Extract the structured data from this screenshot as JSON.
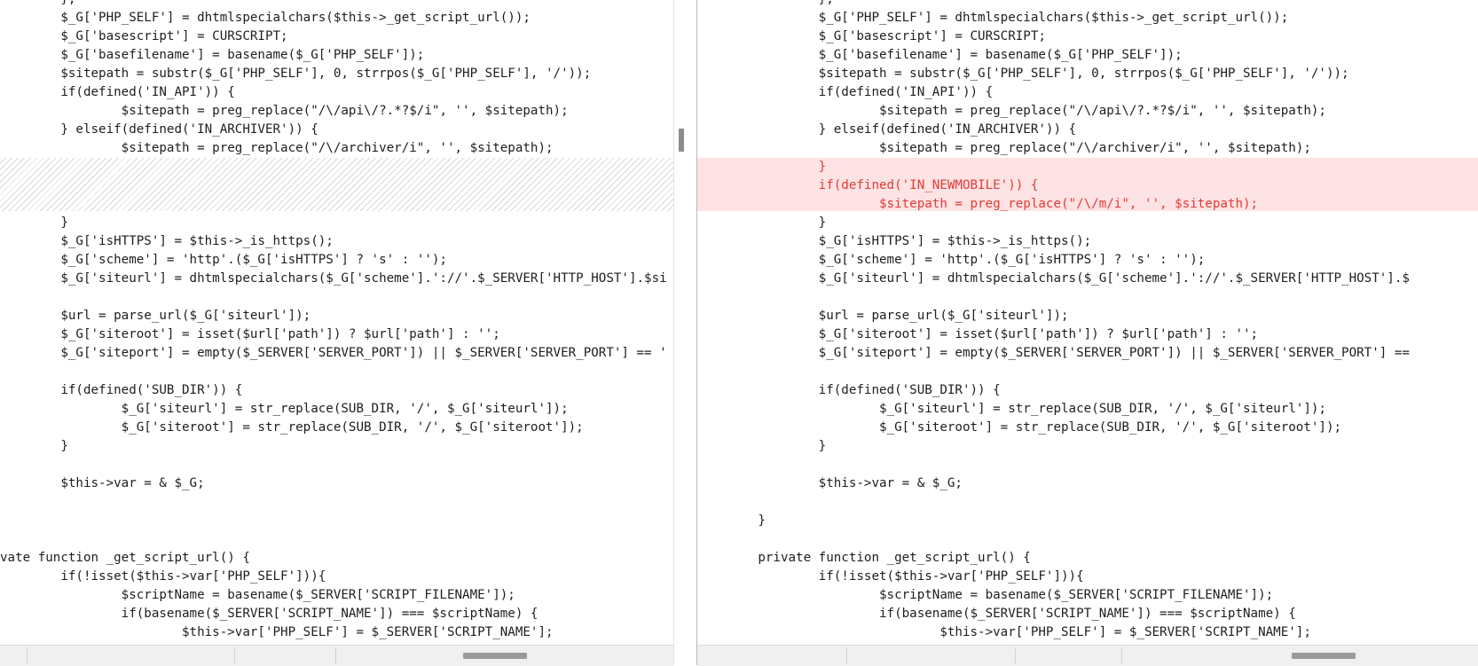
{
  "left_pane": {
    "lines": [
      "        },",
      "        $_G['PHP_SELF'] = dhtmlspecialchars($this->_get_script_url());",
      "        $_G['basescript'] = CURSCRIPT;",
      "        $_G['basefilename'] = basename($_G['PHP_SELF']);",
      "        $sitepath = substr($_G['PHP_SELF'], 0, strrpos($_G['PHP_SELF'], '/'));",
      "        if(defined('IN_API')) {",
      "                $sitepath = preg_replace(\"/\\/api\\/?.*?$/i\", '', $sitepath);",
      "        } elseif(defined('IN_ARCHIVER')) {",
      "                $sitepath = preg_replace(\"/\\/archiver/i\", '', $sitepath);",
      "",
      "",
      "",
      "        }",
      "        $_G['isHTTPS'] = $this->_is_https();",
      "        $_G['scheme'] = 'http'.($_G['isHTTPS'] ? 's' : '');",
      "        $_G['siteurl'] = dhtmlspecialchars($_G['scheme'].'://'.$_SERVER['HTTP_HOST'].$si",
      "",
      "        $url = parse_url($_G['siteurl']);",
      "        $_G['siteroot'] = isset($url['path']) ? $url['path'] : '';",
      "        $_G['siteport'] = empty($_SERVER['SERVER_PORT']) || $_SERVER['SERVER_PORT'] == '",
      "",
      "        if(defined('SUB_DIR')) {",
      "                $_G['siteurl'] = str_replace(SUB_DIR, '/', $_G['siteurl']);",
      "                $_G['siteroot'] = str_replace(SUB_DIR, '/', $_G['siteroot']);",
      "        }",
      "",
      "        $this->var = & $_G;",
      "",
      "",
      "",
      "vate function _get_script_url() {",
      "        if(!isset($this->var['PHP_SELF'])){",
      "                $scriptName = basename($_SERVER['SCRIPT_FILENAME']);",
      "                if(basename($_SERVER['SCRIPT_NAME']) === $scriptName) {",
      "                        $this->var['PHP_SELF'] = $_SERVER['SCRIPT_NAME'];"
    ]
  },
  "right_pane": {
    "lines": [
      "                },",
      "                $_G['PHP_SELF'] = dhtmlspecialchars($this->_get_script_url());",
      "                $_G['basescript'] = CURSCRIPT;",
      "                $_G['basefilename'] = basename($_G['PHP_SELF']);",
      "                $sitepath = substr($_G['PHP_SELF'], 0, strrpos($_G['PHP_SELF'], '/'));",
      "                if(defined('IN_API')) {",
      "                        $sitepath = preg_replace(\"/\\/api\\/?.*?$/i\", '', $sitepath);",
      "                } elseif(defined('IN_ARCHIVER')) {",
      "                        $sitepath = preg_replace(\"/\\/archiver/i\", '', $sitepath);",
      "                }",
      "                if(defined('IN_NEWMOBILE')) {",
      "                        $sitepath = preg_replace(\"/\\/m/i\", '', $sitepath);",
      "                }",
      "                $_G['isHTTPS'] = $this->_is_https();",
      "                $_G['scheme'] = 'http'.($_G['isHTTPS'] ? 's' : '');",
      "                $_G['siteurl'] = dhtmlspecialchars($_G['scheme'].'://'.$_SERVER['HTTP_HOST'].$",
      "",
      "                $url = parse_url($_G['siteurl']);",
      "                $_G['siteroot'] = isset($url['path']) ? $url['path'] : '';",
      "                $_G['siteport'] = empty($_SERVER['SERVER_PORT']) || $_SERVER['SERVER_PORT'] ==",
      "",
      "                if(defined('SUB_DIR')) {",
      "                        $_G['siteurl'] = str_replace(SUB_DIR, '/', $_G['siteurl']);",
      "                        $_G['siteroot'] = str_replace(SUB_DIR, '/', $_G['siteroot']);",
      "                }",
      "",
      "                $this->var = & $_G;",
      "",
      "        }",
      "",
      "        private function _get_script_url() {",
      "                if(!isset($this->var['PHP_SELF'])){",
      "                        $scriptName = basename($_SERVER['SCRIPT_FILENAME']);",
      "                        if(basename($_SERVER['SCRIPT_NAME']) === $scriptName) {",
      "                                $this->var['PHP_SELF'] = $_SERVER['SCRIPT_NAME'];"
    ],
    "added_lines": [
      9,
      10,
      11
    ]
  },
  "icons": {
    "diff_arrow": "arrow-left-icon"
  },
  "colors": {
    "added_text": "#e53935",
    "added_background": "#fde3e3",
    "gap_hatch": "#d9d9d9"
  }
}
